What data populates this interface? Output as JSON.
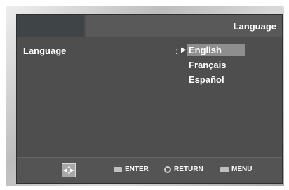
{
  "header": {
    "title": "Language"
  },
  "setting": {
    "label": "Language",
    "separator": ":"
  },
  "options": [
    {
      "label": "English",
      "selected": true
    },
    {
      "label": "Français",
      "selected": false
    },
    {
      "label": "Español",
      "selected": false
    }
  ],
  "footer": {
    "enter_label": "ENTER",
    "return_label": "RETURN",
    "menu_label": "MENU"
  }
}
